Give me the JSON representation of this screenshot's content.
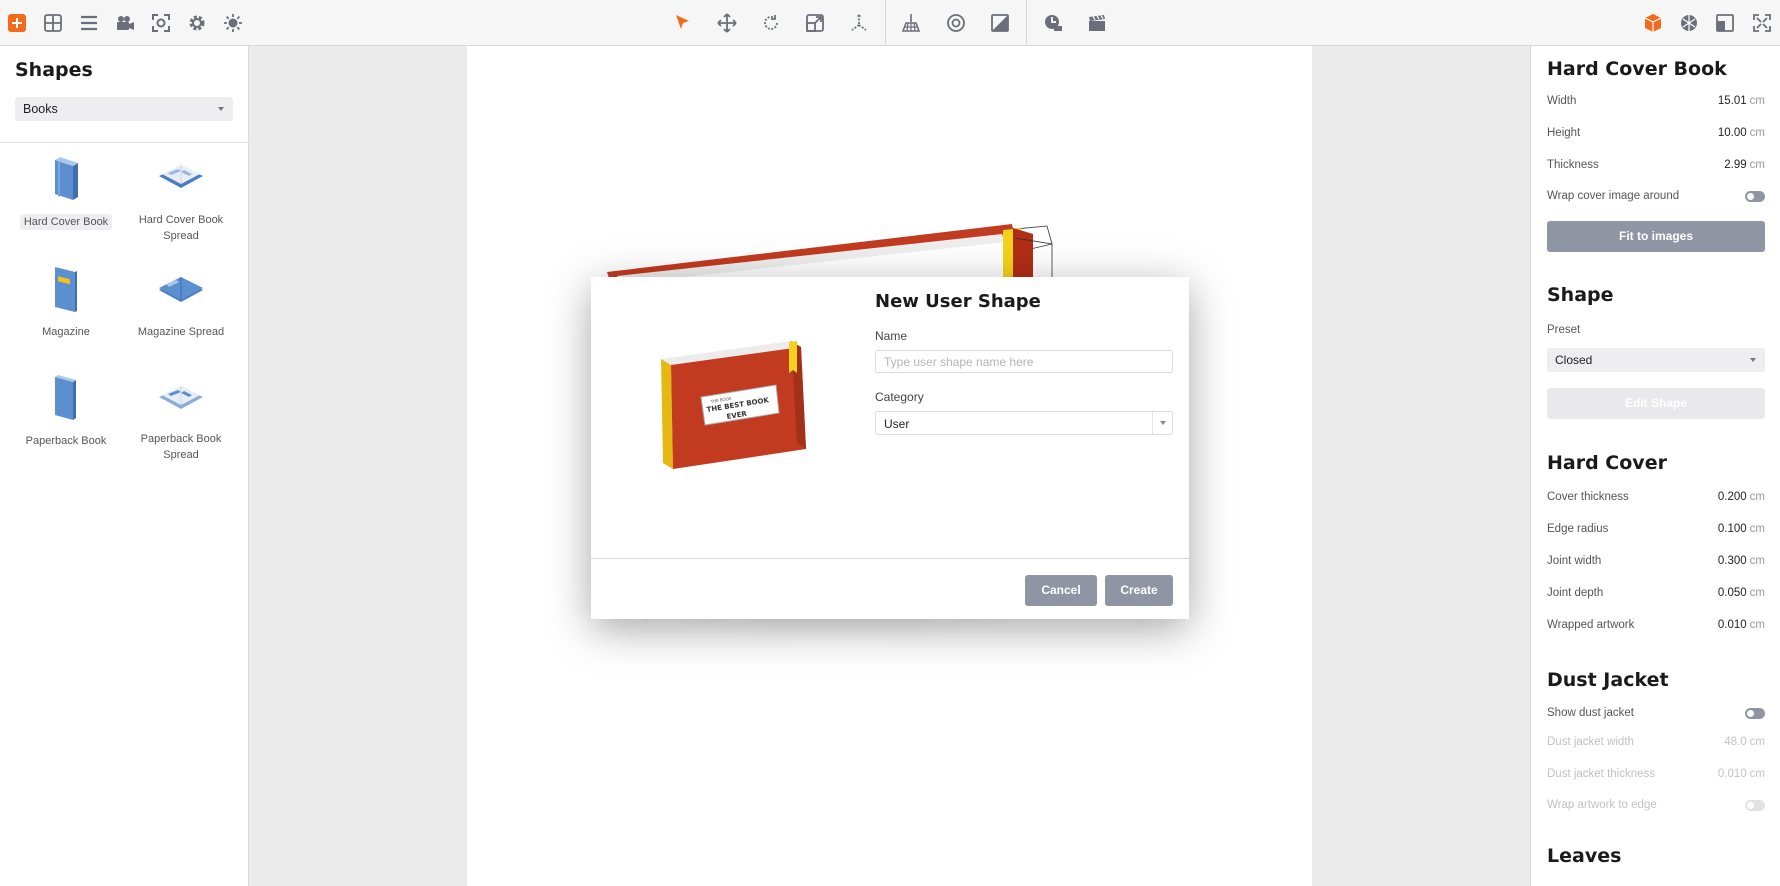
{
  "toolbar": {
    "left_icons": [
      "add-icon",
      "grid-icon",
      "menu-icon",
      "camera-icon",
      "focus-icon",
      "gear-icon",
      "light-icon"
    ],
    "center_icons": [
      "pointer-icon",
      "move-icon",
      "rotate-icon",
      "scale-icon",
      "axes-icon",
      "floor-icon",
      "sphere-view-icon",
      "material-icon",
      "animation-icon",
      "clapper-icon"
    ],
    "right_icons": [
      "cube-icon",
      "texture-icon",
      "layout-icon",
      "fullscreen-icon"
    ],
    "accent_color": "#f26b1d"
  },
  "left_panel": {
    "title": "Shapes",
    "category_select": "Books",
    "items": [
      {
        "label": "Hard Cover Book",
        "selected": true,
        "icon": "hardcover-book-icon"
      },
      {
        "label": "Hard Cover Book Spread",
        "selected": false,
        "icon": "hardcover-spread-icon"
      },
      {
        "label": "Magazine",
        "selected": false,
        "icon": "magazine-icon"
      },
      {
        "label": "Magazine Spread",
        "selected": false,
        "icon": "magazine-spread-icon"
      },
      {
        "label": "Paperback Book",
        "selected": false,
        "icon": "paperback-book-icon"
      },
      {
        "label": "Paperback Book Spread",
        "selected": false,
        "icon": "paperback-spread-icon"
      }
    ]
  },
  "modal": {
    "title": "New User Shape",
    "name_label": "Name",
    "name_placeholder": "Type user shape name here",
    "category_label": "Category",
    "category_value": "User",
    "cancel_label": "Cancel",
    "create_label": "Create",
    "preview_book_lines": [
      "THE BOOK",
      "THE BEST BOOK",
      "EVER"
    ]
  },
  "right_panel": {
    "title": "Hard Cover Book",
    "dimensions": [
      {
        "label": "Width",
        "value": "15.01",
        "unit": "cm"
      },
      {
        "label": "Height",
        "value": "10.00",
        "unit": "cm"
      },
      {
        "label": "Thickness",
        "value": "2.99",
        "unit": "cm"
      }
    ],
    "wrap_cover_label": "Wrap cover image around",
    "fit_button": "Fit to images",
    "shape_section": "Shape",
    "preset_label": "Preset",
    "preset_value": "Closed",
    "edit_shape_button": "Edit Shape",
    "hard_cover_section": "Hard Cover",
    "hard_cover_props": [
      {
        "label": "Cover thickness",
        "value": "0.200",
        "unit": "cm"
      },
      {
        "label": "Edge radius",
        "value": "0.100",
        "unit": "cm"
      },
      {
        "label": "Joint width",
        "value": "0.300",
        "unit": "cm"
      },
      {
        "label": "Joint depth",
        "value": "0.050",
        "unit": "cm"
      },
      {
        "label": "Wrapped artwork",
        "value": "0.010",
        "unit": "cm"
      }
    ],
    "dust_jacket_section": "Dust Jacket",
    "show_dust_jacket_label": "Show dust jacket",
    "dust_jacket_props": [
      {
        "label": "Dust jacket width",
        "value": "48.0",
        "unit": "cm"
      },
      {
        "label": "Dust jacket thickness",
        "value": "0.010",
        "unit": "cm"
      }
    ],
    "wrap_artwork_label": "Wrap artwork to edge",
    "leaves_section": "Leaves"
  }
}
